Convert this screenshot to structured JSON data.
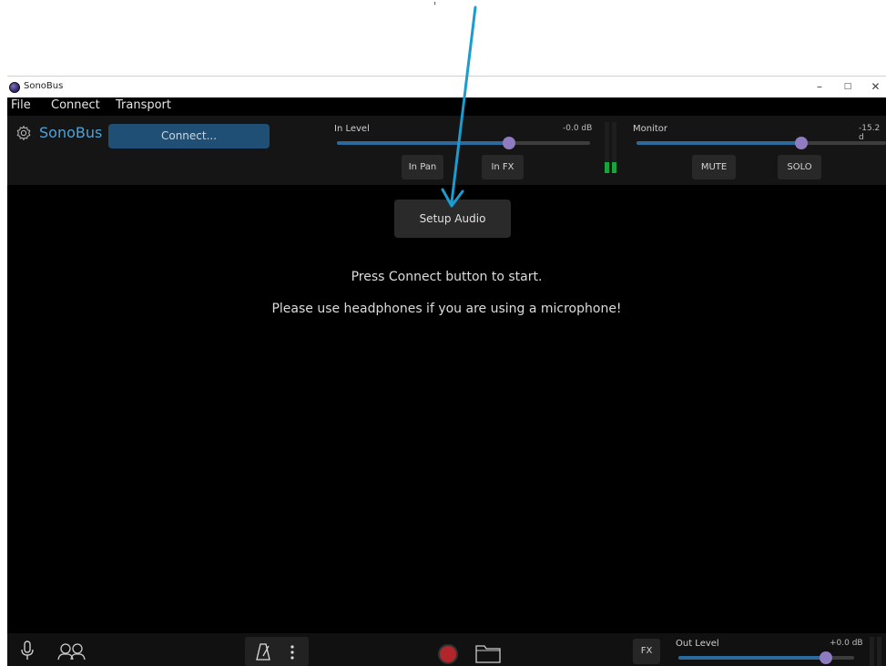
{
  "window": {
    "title": "SonoBus"
  },
  "menu": [
    "File",
    "Connect",
    "Transport"
  ],
  "topbar": {
    "brand": "SonoBus",
    "connect_label": "Connect...",
    "in_level": {
      "label": "In Level",
      "value_text": "-0.0 dB",
      "level": 0.68
    },
    "in_pan_label": "In Pan",
    "in_fx_label": "In FX",
    "monitor": {
      "label": "Monitor",
      "value_text": "-15.2 d",
      "level": 0.66
    },
    "mute_label": "MUTE",
    "solo_label": "SOLO",
    "input_meter_level": 0.22
  },
  "main": {
    "setup_audio_label": "Setup Audio",
    "message_1": "Press Connect button to start.",
    "message_2": "Please use headphones if you are using a microphone!"
  },
  "bottombar": {
    "fx_label": "FX",
    "out_level": {
      "label": "Out Level",
      "value_text": "+0.0 dB",
      "level": 0.84
    }
  },
  "colors": {
    "accent": "#4ba3dc",
    "slider_fill": "#2a6a9c",
    "slider_thumb": "#8f7cc0",
    "meter_green": "#1aa33a",
    "record": "#b0262a",
    "annotation_arrow": "#1a9ccf"
  },
  "icons": [
    "app-logo-icon",
    "gear-icon",
    "microphone-icon",
    "people-icon",
    "metronome-icon",
    "more-vertical-icon",
    "record-icon",
    "folder-icon",
    "minimize-icon",
    "maximize-icon",
    "close-icon"
  ]
}
